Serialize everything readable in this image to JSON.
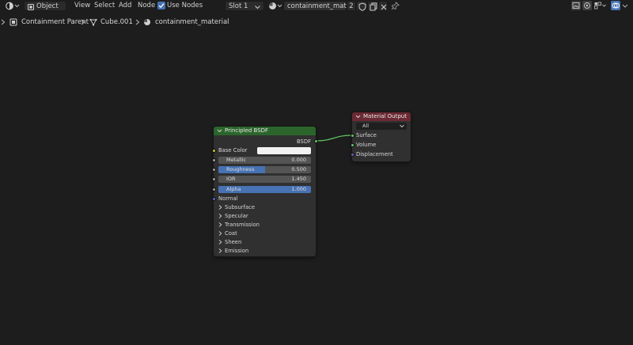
{
  "header": {
    "mode_label": "Object",
    "menu": [
      "View",
      "Select",
      "Add",
      "Node"
    ],
    "use_nodes_label": "Use Nodes",
    "slot_label": "Slot 1",
    "material_name": "containment_material",
    "user_count": "2"
  },
  "breadcrumb": {
    "items": [
      "Containment Parent",
      "Cube.001",
      "containment_material"
    ]
  },
  "nodes": {
    "principled": {
      "title": "Principled BSDF",
      "header_color": "#2b652b",
      "output_label": "BSDF",
      "base_color_label": "Base Color",
      "base_color_value": "#f2f2f2",
      "fields": [
        {
          "label": "Metallic",
          "value": "0.000",
          "fill": 0.0
        },
        {
          "label": "Roughness",
          "value": "0.500",
          "fill": 0.5
        },
        {
          "label": "IOR",
          "value": "1.450",
          "fill": 0.0
        },
        {
          "label": "Alpha",
          "value": "1.000",
          "fill": 1.0
        }
      ],
      "normal_label": "Normal",
      "panels": [
        "Subsurface",
        "Specular",
        "Transmission",
        "Coat",
        "Sheen",
        "Emission"
      ]
    },
    "output": {
      "title": "Material Output",
      "header_color": "#6b2a33",
      "target_value": "All",
      "inputs": [
        "Surface",
        "Volume",
        "Displacement"
      ]
    }
  },
  "colors": {
    "accent": "#4772b3",
    "socket_shader": "#63c763",
    "socket_color": "#c7c729",
    "socket_float": "#a1a1a1",
    "socket_vector": "#6363c7",
    "link": "#63c763"
  }
}
